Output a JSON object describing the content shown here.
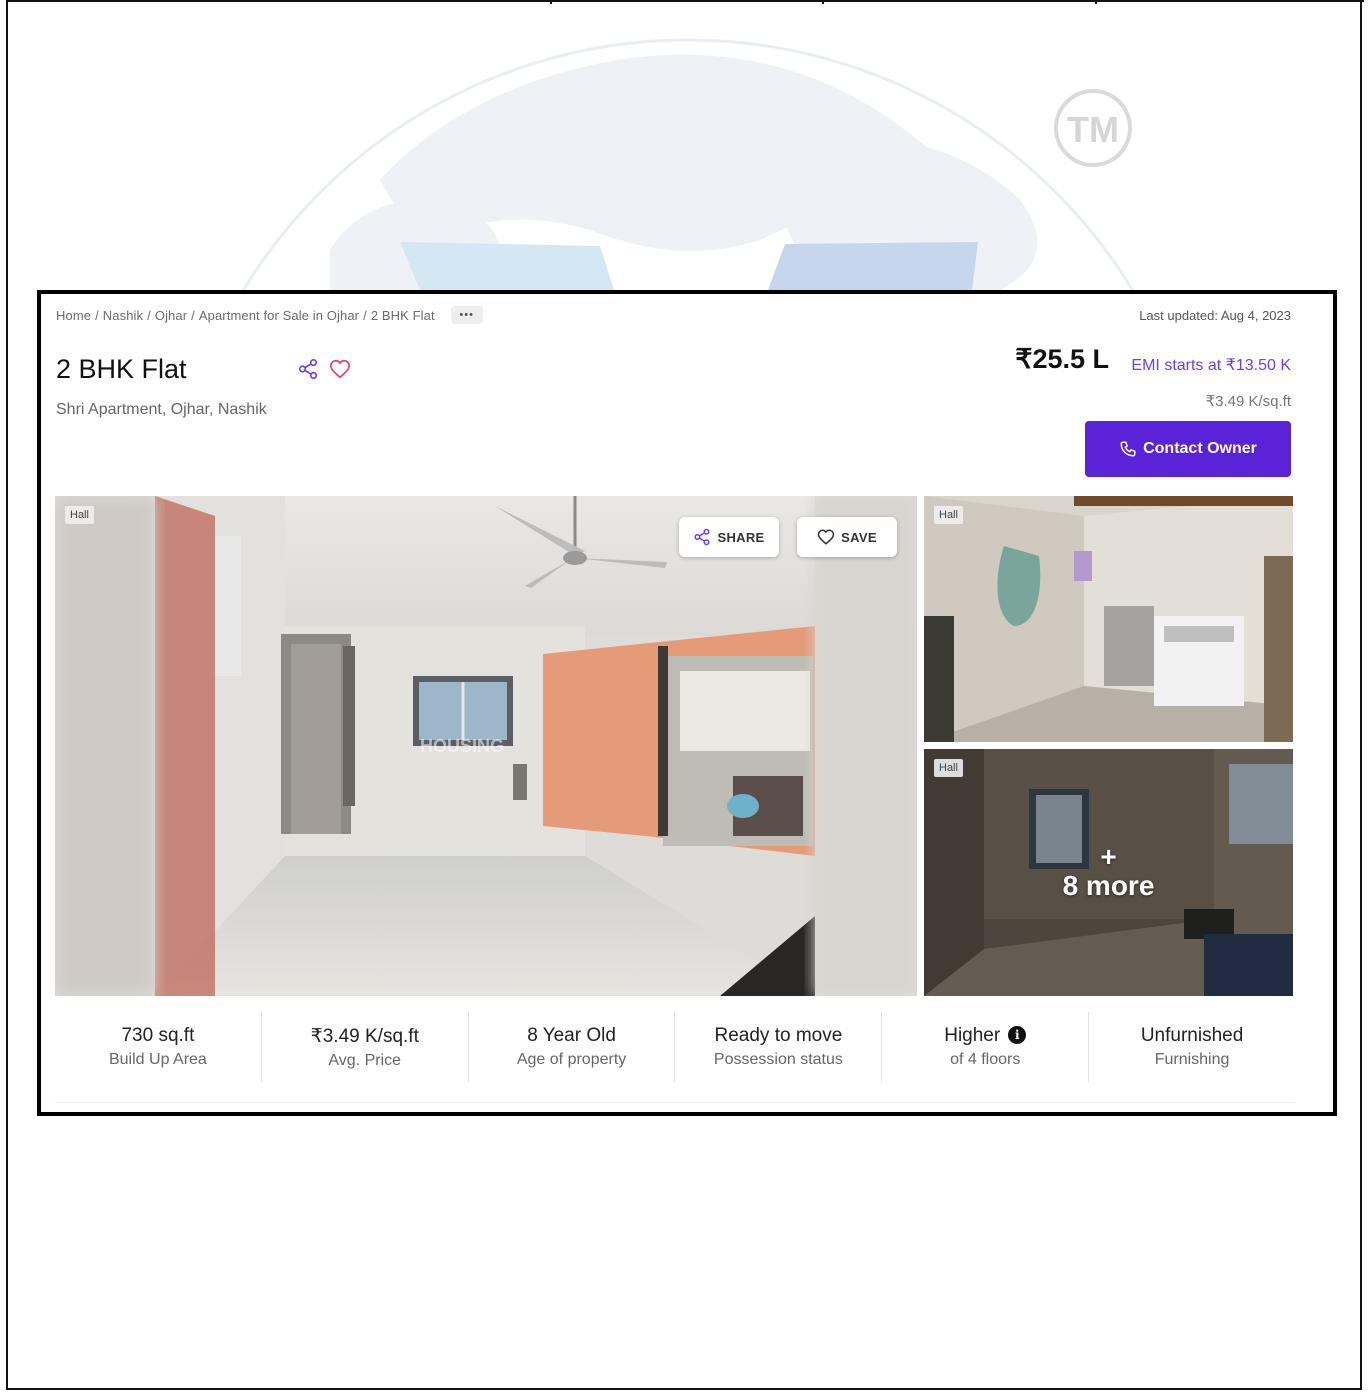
{
  "breadcrumb": {
    "items": [
      "Home",
      "Nashik",
      "Ojhar",
      "Apartment for Sale in Ojhar",
      "2 BHK Flat"
    ],
    "more": "•••"
  },
  "last_updated": "Last updated: Aug 4, 2023",
  "listing": {
    "title": "2 BHK Flat",
    "location": "Shri Apartment, Ojhar, Nashik",
    "price": "₹25.5 L",
    "emi": "EMI starts at ₹13.50 K",
    "price_per_sqft": "₹3.49 K/sq.ft",
    "contact_label": "Contact Owner"
  },
  "gallery": {
    "hero_tag": "Hall",
    "share_label": "SHARE",
    "save_label": "SAVE",
    "watermark_text": "HOUSING",
    "thumb1_tag": "Hall",
    "thumb2_tag": "Hall",
    "more_plus": "+",
    "more_label": "8 more"
  },
  "stats": [
    {
      "value": "730 sq.ft",
      "label": "Build Up Area"
    },
    {
      "value": "₹3.49 K/sq.ft",
      "label": "Avg. Price"
    },
    {
      "value": "8 Year Old",
      "label": "Age of property"
    },
    {
      "value": "Ready to move",
      "label": "Possession status"
    },
    {
      "value": "Higher",
      "label": "of 4 floors"
    },
    {
      "value": "Unfurnished",
      "label": "Furnishing"
    }
  ],
  "watermark": {
    "mark": "TM"
  },
  "colors": {
    "accent": "#5a23d8",
    "emi_text": "#6d3ef0",
    "heart": "#e0436b"
  }
}
